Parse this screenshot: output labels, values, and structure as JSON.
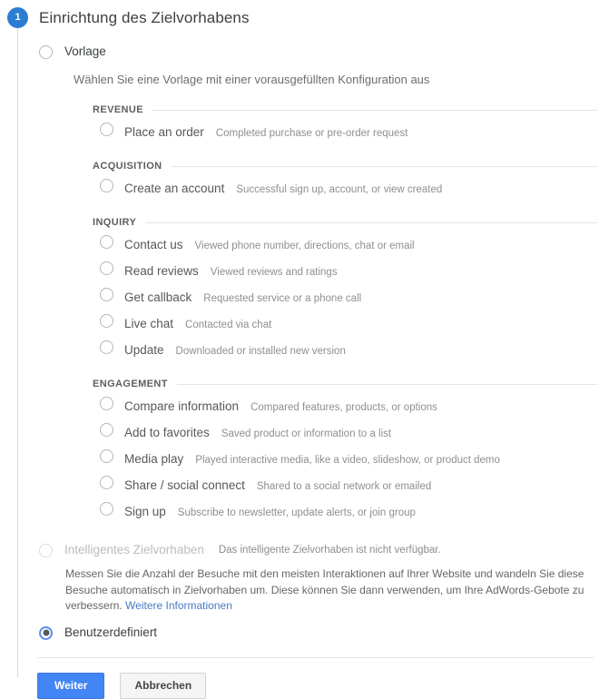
{
  "step": {
    "number": "1",
    "title": "Einrichtung des Zielvorhabens"
  },
  "options": {
    "template": {
      "label": "Vorlage",
      "helper": "Wählen Sie eine Vorlage mit einer vorausgefüllten Konfiguration aus"
    },
    "smart_goal": {
      "label": "Intelligentes Zielvorhaben",
      "note": "Das intelligente Zielvorhaben ist nicht verfügbar.",
      "paragraph": "Messen Sie die Anzahl der Besuche mit den meisten Interaktionen auf Ihrer Website und wandeln Sie diese Besuche automatisch in Zielvorhaben um. Diese können Sie dann verwenden, um Ihre AdWords-Gebote zu verbessern. ",
      "link_text": "Weitere Informationen"
    },
    "custom": {
      "label": "Benutzerdefiniert"
    }
  },
  "template_groups": [
    {
      "title": "REVENUE",
      "items": [
        {
          "label": "Place an order",
          "desc": "Completed purchase or pre-order request"
        }
      ]
    },
    {
      "title": "ACQUISITION",
      "items": [
        {
          "label": "Create an account",
          "desc": "Successful sign up, account, or view created"
        }
      ]
    },
    {
      "title": "INQUIRY",
      "items": [
        {
          "label": "Contact us",
          "desc": "Viewed phone number, directions, chat or email"
        },
        {
          "label": "Read reviews",
          "desc": "Viewed reviews and ratings"
        },
        {
          "label": "Get callback",
          "desc": "Requested service or a phone call"
        },
        {
          "label": "Live chat",
          "desc": "Contacted via chat"
        },
        {
          "label": "Update",
          "desc": "Downloaded or installed new version"
        }
      ]
    },
    {
      "title": "ENGAGEMENT",
      "items": [
        {
          "label": "Compare information",
          "desc": "Compared features, products, or options"
        },
        {
          "label": "Add to favorites",
          "desc": "Saved product or information to a list"
        },
        {
          "label": "Media play",
          "desc": "Played interactive media, like a video, slideshow, or product demo"
        },
        {
          "label": "Share / social connect",
          "desc": "Shared to a social network or emailed"
        },
        {
          "label": "Sign up",
          "desc": "Subscribe to newsletter, update alerts, or join group"
        }
      ]
    }
  ],
  "footer": {
    "continue_label": "Weiter",
    "cancel_label": "Abbrechen"
  },
  "colors": {
    "accent": "#4285f4",
    "badge": "#2b7dd2",
    "link": "#4a79c4"
  }
}
